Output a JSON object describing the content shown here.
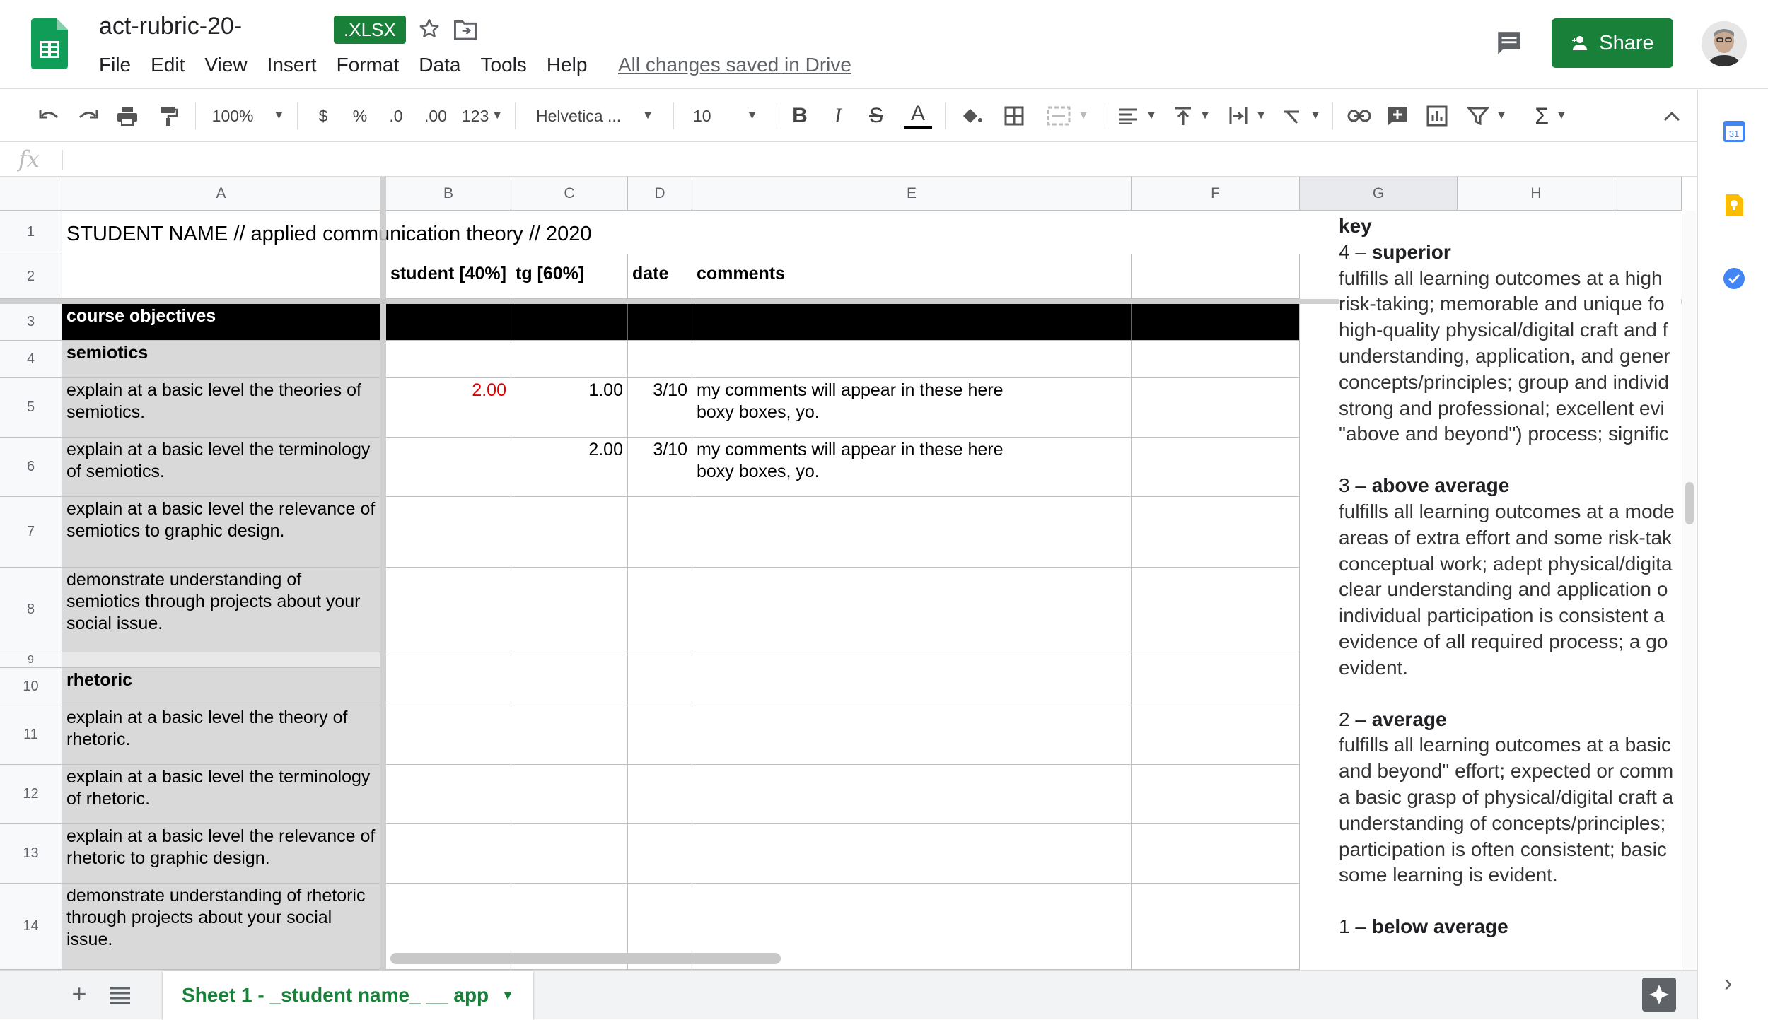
{
  "document": {
    "title": "act-rubric-20-",
    "format_badge": ".XLSX",
    "save_status": "All changes saved in Drive"
  },
  "menu": [
    "File",
    "Edit",
    "View",
    "Insert",
    "Format",
    "Data",
    "Tools",
    "Help"
  ],
  "share": {
    "label": "Share"
  },
  "toolbar": {
    "zoom": "100%",
    "currency": "$",
    "percent": "%",
    "decrease_decimals": ".0",
    "increase_decimals": ".00",
    "more_formats": "123",
    "font_family": "Helvetica ...",
    "font_size": "10"
  },
  "grid": {
    "columns": [
      "A",
      "B",
      "C",
      "D",
      "E",
      "F",
      "G",
      "H"
    ],
    "selected_column": "G",
    "rows": [
      "1",
      "2",
      "3",
      "4",
      "5",
      "6",
      "7",
      "8",
      "9",
      "10",
      "11",
      "12",
      "13",
      "14"
    ],
    "cells": {
      "A1": "STUDENT NAME  // applied communication theory // 2020",
      "B2": "student [40%]",
      "C2": "tg [60%]",
      "D2": "date",
      "E2": "comments",
      "A3": "course objectives",
      "A4": "semiotics",
      "A5": "explain at a basic level the theories of semiotics.",
      "B5": "2.00",
      "C5": "1.00",
      "D5": "3/10",
      "E5": "my comments will appear in these here boxy boxes, yo.",
      "A6": "explain at a basic level the terminology of semiotics.",
      "C6": "2.00",
      "D6": "3/10",
      "E6": "my comments will appear in these here boxy boxes, yo.",
      "A7": "explain at a basic level the relevance of semiotics to graphic design.",
      "A8": "demonstrate understanding of semiotics through projects about your social issue.",
      "A10": "rhetoric",
      "A11": "explain at a basic level the theory of rhetoric.",
      "A12": "explain at a basic level the terminology of rhetoric.",
      "A13": "explain at a basic level the relevance of rhetoric to graphic design.",
      "A14": "demonstrate understanding of rhetoric through projects about your social issue."
    }
  },
  "key": {
    "title": "key",
    "levels": [
      {
        "num": "4 –",
        "name": "superior",
        "lines": [
          "fulfills all learning outcomes at a high",
          "risk-taking; memorable and unique fo",
          "high-quality physical/digital craft and f",
          "understanding, application, and gener",
          "concepts/principles; group and individ",
          "strong and professional; excellent evi",
          "\"above and beyond\") process; signific"
        ]
      },
      {
        "num": "3 –",
        "name": "above average",
        "lines": [
          "fulfills all learning outcomes at a mode",
          "areas of extra effort and some risk-tak",
          "conceptual work; adept physical/digita",
          "clear understanding and application o",
          "individual participation is consistent a",
          "evidence of all required process; a go",
          "evident."
        ]
      },
      {
        "num": "2 –",
        "name": "average",
        "lines": [
          "fulfills all learning outcomes at a basic",
          "and beyond\" effort; expected or comm",
          "a basic grasp of physical/digital craft a",
          "understanding of concepts/principles;",
          "participation is often consistent; basic",
          "some learning is evident."
        ]
      },
      {
        "num": "1 –",
        "name": "below average",
        "lines": []
      }
    ]
  },
  "sheet_tab": {
    "label": "Sheet 1 - _student name_ __ app"
  },
  "colors": {
    "brand_green": "#188038",
    "header_gray": "#f8f9fa",
    "objective_gray": "#d9d9d9",
    "value_red": "#e00000"
  },
  "icons": [
    "sheets-logo-icon",
    "star-icon",
    "move-to-folder-icon",
    "comments-icon",
    "person-add-icon",
    "undo-icon",
    "redo-icon",
    "print-icon",
    "paint-format-icon",
    "bold-icon",
    "italic-icon",
    "strikethrough-icon",
    "text-color-icon",
    "fill-color-icon",
    "borders-icon",
    "merge-cells-icon",
    "align-icon",
    "valign-icon",
    "wrap-icon",
    "rotate-icon",
    "link-icon",
    "insert-comment-icon",
    "insert-chart-icon",
    "filter-icon",
    "functions-icon",
    "collapse-icon",
    "calendar-icon",
    "keep-icon",
    "tasks-icon",
    "add-sheet-icon",
    "all-sheets-icon",
    "explore-icon",
    "chevron-right-icon"
  ]
}
